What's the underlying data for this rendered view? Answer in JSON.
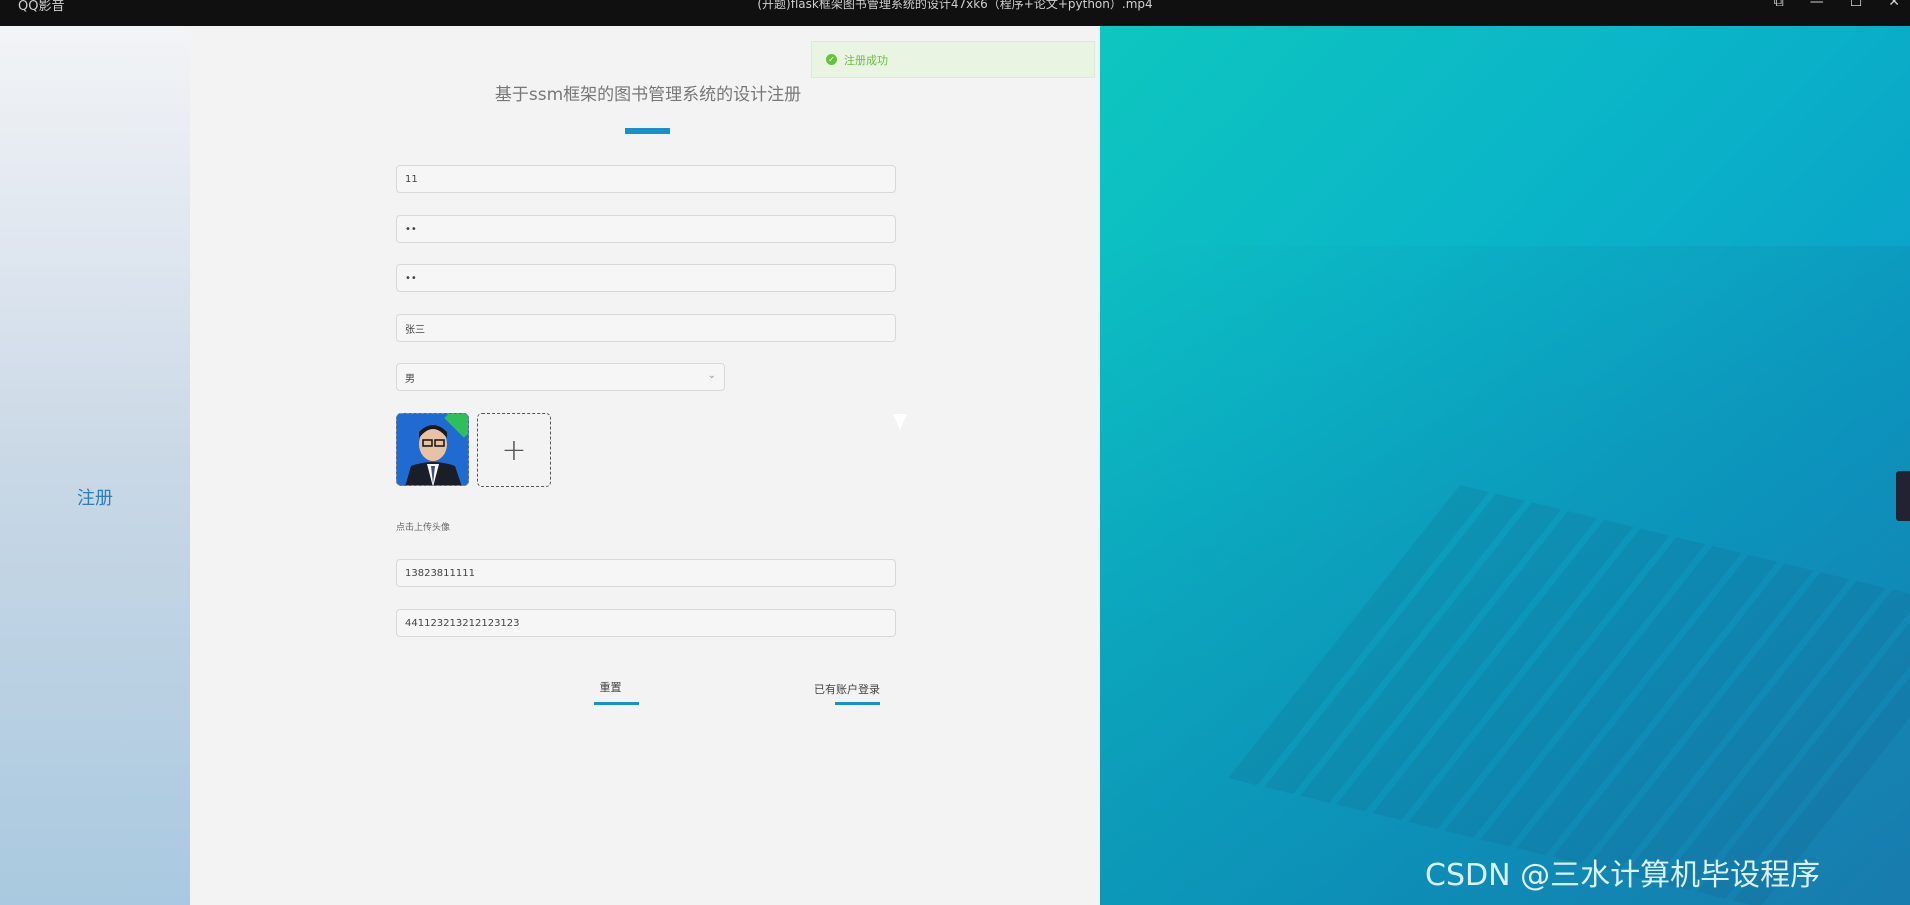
{
  "titlebar": {
    "app_name": "QQ影音",
    "title": "(开题)flask框架图书管理系统的设计47xk6（程序+论文+python）.mp4"
  },
  "sidebar": {
    "title": "注册"
  },
  "form": {
    "title": "基于ssm框架的图书管理系统的设计注册",
    "fields": {
      "account": "11",
      "password": "••",
      "confirm_password": "••",
      "name": "张三",
      "gender": "男",
      "phone": "13823811111",
      "id_number": "441123213212123123"
    },
    "upload_hint": "点击上传头像",
    "reset_label": "重置",
    "login_link_label": "已有账户登录"
  },
  "toast": {
    "message": "注册成功"
  },
  "watermark": "CSDN @三水计算机毕设程序",
  "colors": {
    "accent": "#1791cc",
    "success": "#67c23a",
    "sidebar_title": "#2a7fb8"
  }
}
